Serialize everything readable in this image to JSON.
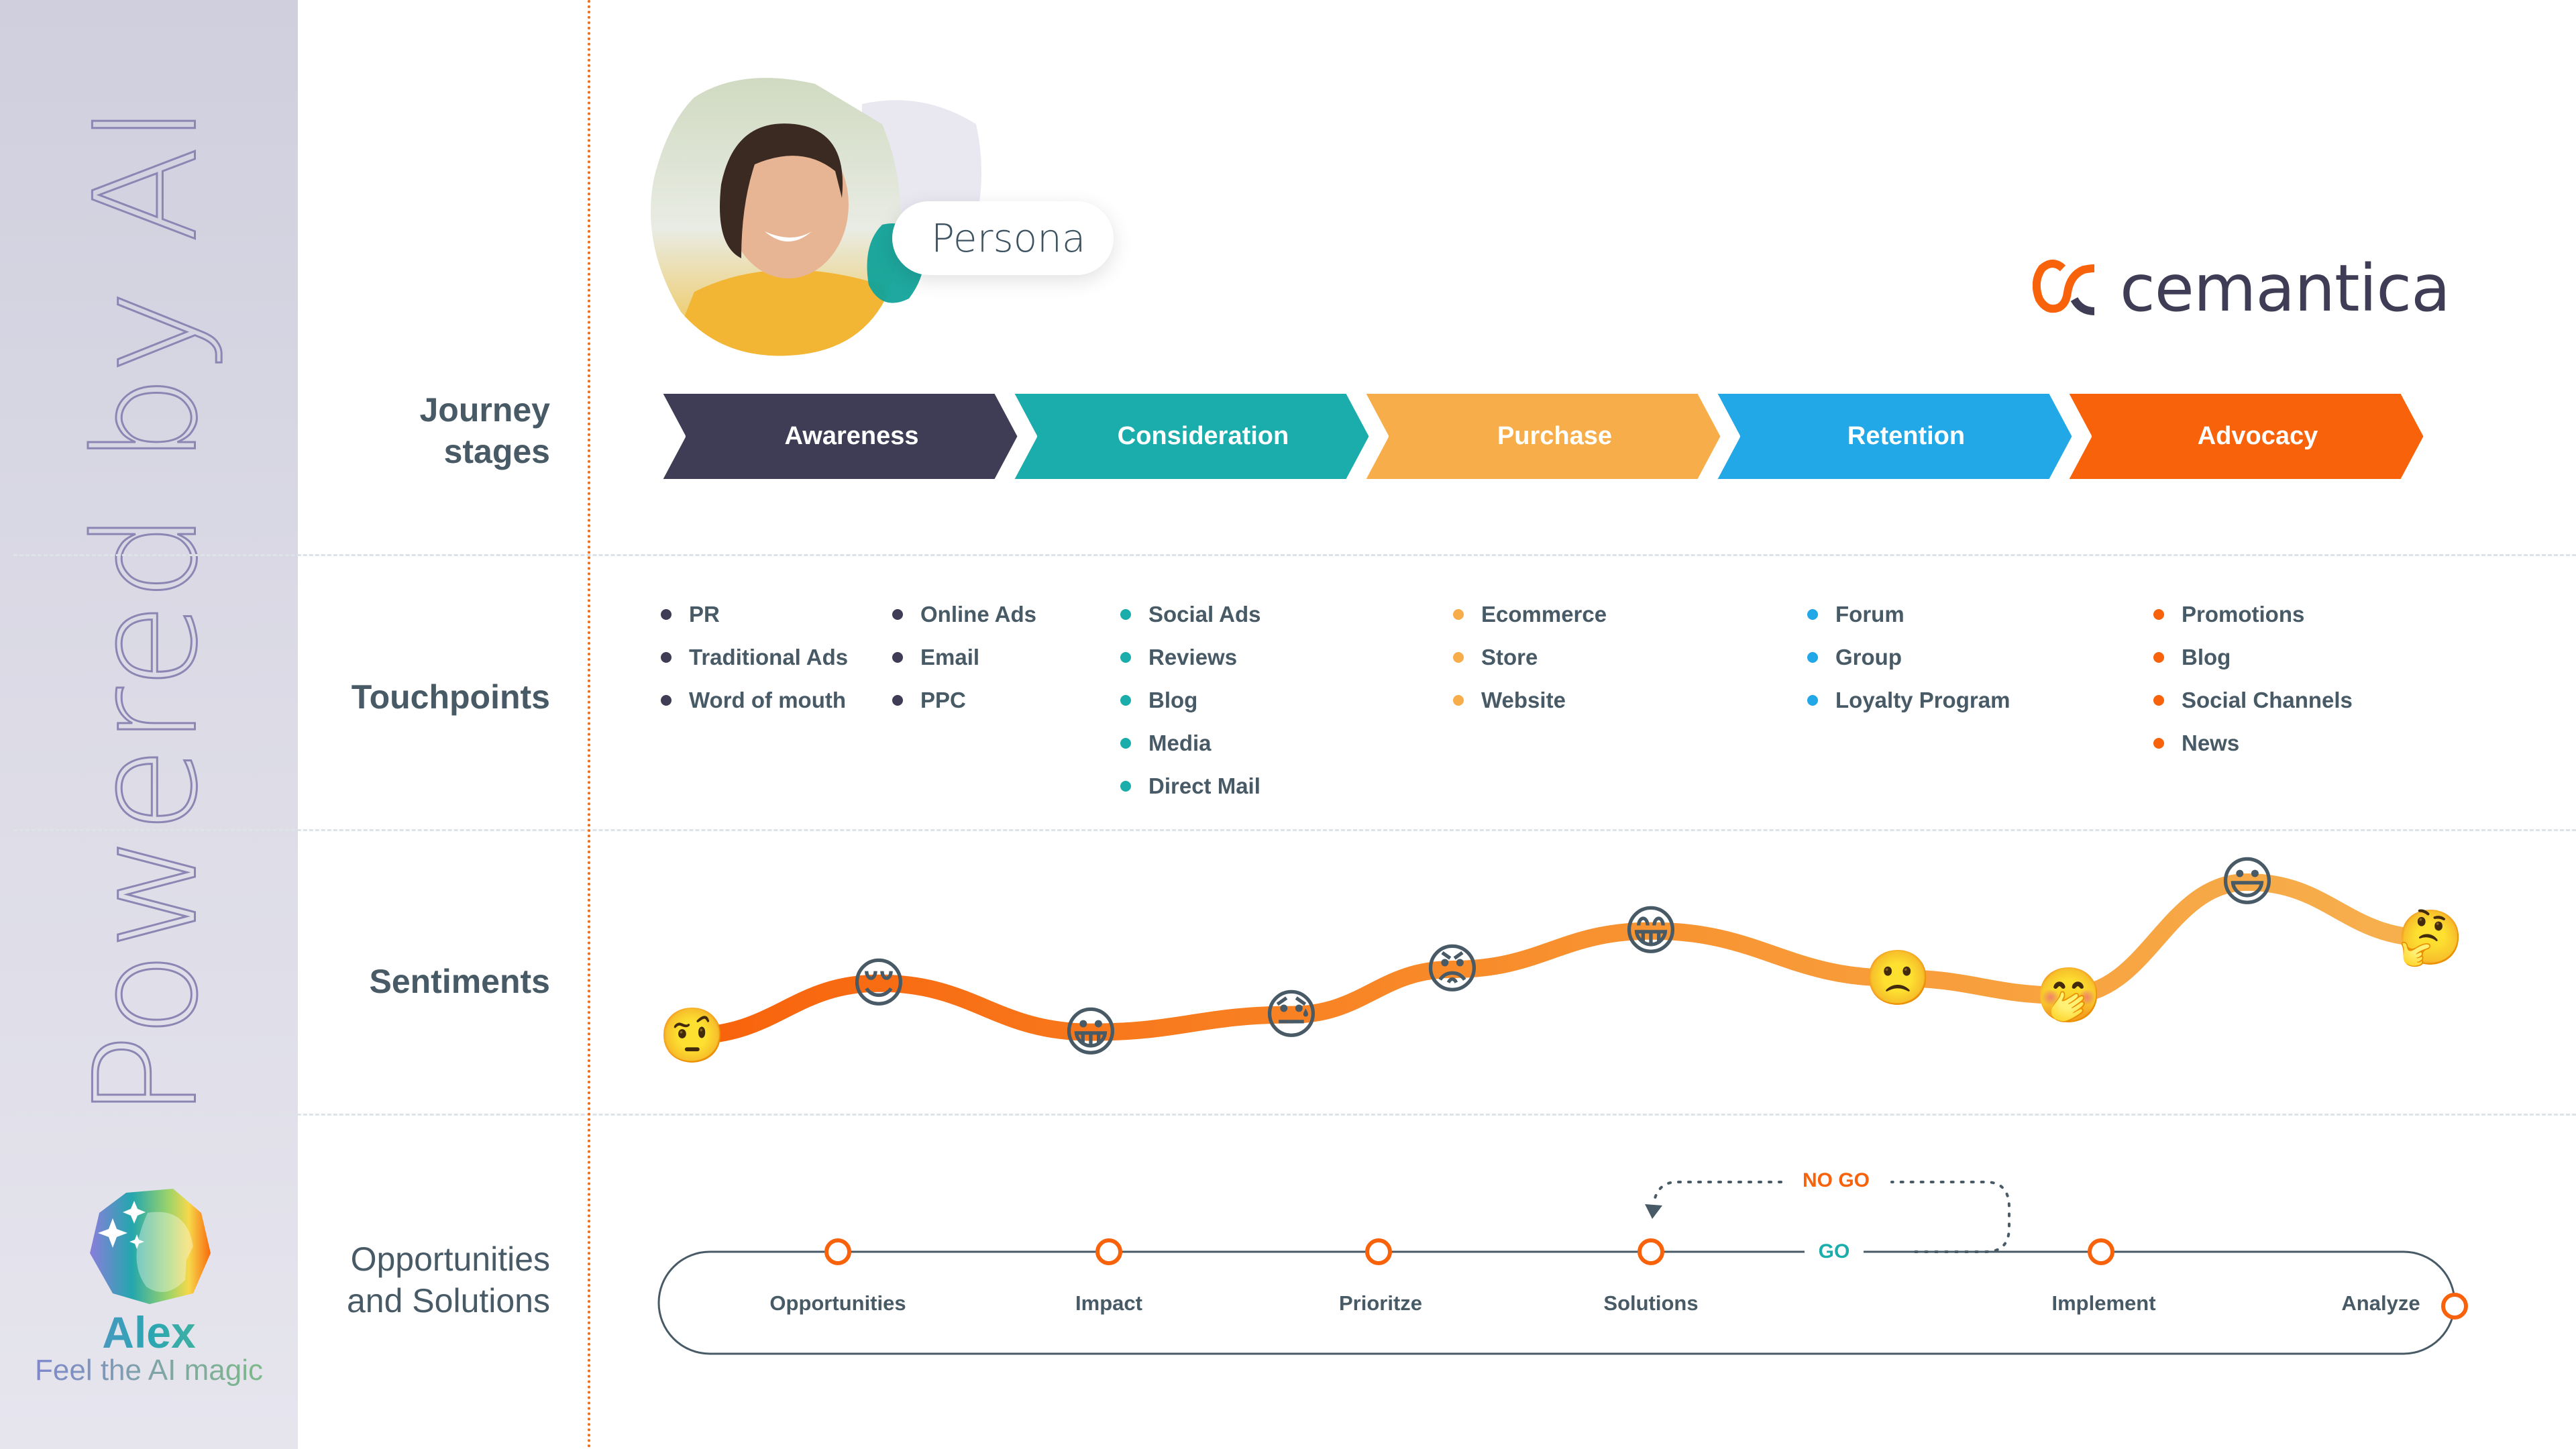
{
  "sidebar": {
    "vertical_text": "Powered by AI",
    "assistant_name": "Alex",
    "assistant_tagline": "Feel the AI magic",
    "logo_icon": "ai-head-sparkles-icon"
  },
  "persona": {
    "label": "Persona",
    "photo": "smiling-woman-yellow-shirt-photo"
  },
  "brand": {
    "name": "cemantica",
    "icon": "cemantica-cc-logo-icon"
  },
  "row_labels": {
    "journey_line1": "Journey",
    "journey_line2": "stages",
    "touchpoints": "Touchpoints",
    "sentiments": "Sentiments",
    "opportunities_line1": "Opportunities",
    "opportunities_line2": "and Solutions"
  },
  "stages": [
    {
      "label": "Awareness",
      "color": "#3f3d56"
    },
    {
      "label": "Consideration",
      "color": "#1aadac"
    },
    {
      "label": "Purchase",
      "color": "#f7ae4a"
    },
    {
      "label": "Retention",
      "color": "#22a8e6"
    },
    {
      "label": "Advocacy",
      "color": "#f8620b"
    }
  ],
  "touchpoints": [
    {
      "color": "#3f3d56",
      "items": [
        "PR",
        "Traditional Ads",
        "Word of  mouth"
      ]
    },
    {
      "color": "#3f3d56",
      "items": [
        "Online Ads",
        "Email",
        "PPC"
      ]
    },
    {
      "color": "#1aadac",
      "items": [
        "Social Ads",
        "Reviews",
        "Blog",
        "Media",
        "Direct Mail"
      ]
    },
    {
      "color": "#f7ae4a",
      "items": [
        "Ecommerce",
        "Store",
        "Website"
      ]
    },
    {
      "color": "#22a8e6",
      "items": [
        "Forum",
        "Group",
        "Loyalty Program"
      ]
    },
    {
      "color": "#f8620b",
      "items": [
        "Promotions",
        "Blog",
        "Social Channels",
        "News"
      ]
    }
  ],
  "sentiments": [
    {
      "emoji": "🤨",
      "name": "raised-eyebrow",
      "level": 0.12
    },
    {
      "emoji": "😌",
      "name": "relieved",
      "level": 0.42
    },
    {
      "emoji": "😀",
      "name": "grinning",
      "level": 0.14
    },
    {
      "emoji": "😓",
      "name": "downcast-sweat",
      "level": 0.24
    },
    {
      "emoji": "😡",
      "name": "angry",
      "level": 0.5
    },
    {
      "emoji": "😁",
      "name": "beaming",
      "level": 0.72
    },
    {
      "emoji": "🙁",
      "name": "frowning",
      "level": 0.45
    },
    {
      "emoji": "🤭",
      "name": "hand-over-mouth",
      "level": 0.35
    },
    {
      "emoji": "😃",
      "name": "grinning-big-eyes",
      "level": 1.0
    },
    {
      "emoji": "🤔",
      "name": "thinking",
      "level": 0.68
    }
  ],
  "opportunities": {
    "steps": [
      "Opportunities",
      "Impact",
      "Prioritze",
      "Solutions",
      "Implement",
      "Analyze"
    ],
    "go_label": "GO",
    "no_go_label": "NO GO",
    "colors": {
      "node": "#f8620b",
      "go": "#1aadac",
      "no_go": "#f8620b",
      "track": "#475a66"
    }
  }
}
